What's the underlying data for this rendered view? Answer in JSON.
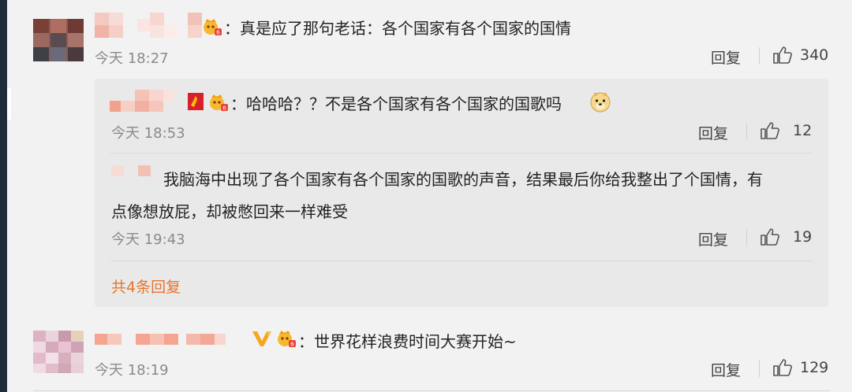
{
  "comments": [
    {
      "text_colon": "：",
      "text": "真是应了那句老话：各个国家有各个国家的国情",
      "time": "今天 18:27",
      "reply_label": "回复",
      "likes": "340",
      "replies": [
        {
          "text_colon": "：",
          "text": "哈哈哈？？不是各个国家有各个国家的国歌吗",
          "emoji": "doge-emoji",
          "time": "今天 18:53",
          "reply_label": "回复",
          "likes": "12"
        },
        {
          "text_line1": "我脑海中出现了各个国家有各个国家的国歌的声音，结果最后你给我整出了个国情，有",
          "text_line2": "点像想放屁，却被憋回来一样难受",
          "time": "今天 19:43",
          "reply_label": "回复",
          "likes": "19"
        }
      ],
      "more_replies": "共4条回复"
    },
    {
      "text_colon": "：",
      "text": "世界花样浪费时间大赛开始~",
      "time": "今天 18:19",
      "reply_label": "回复",
      "likes": "129"
    }
  ],
  "colors": {
    "background": "#f2f2f2",
    "sub_panel": "#e9e9e9",
    "accent": "#e8742c"
  },
  "icons": [
    "thumbs-up-icon",
    "vip-badge-icon",
    "flag-badge-icon",
    "v-badge-icon",
    "doge-emoji"
  ]
}
